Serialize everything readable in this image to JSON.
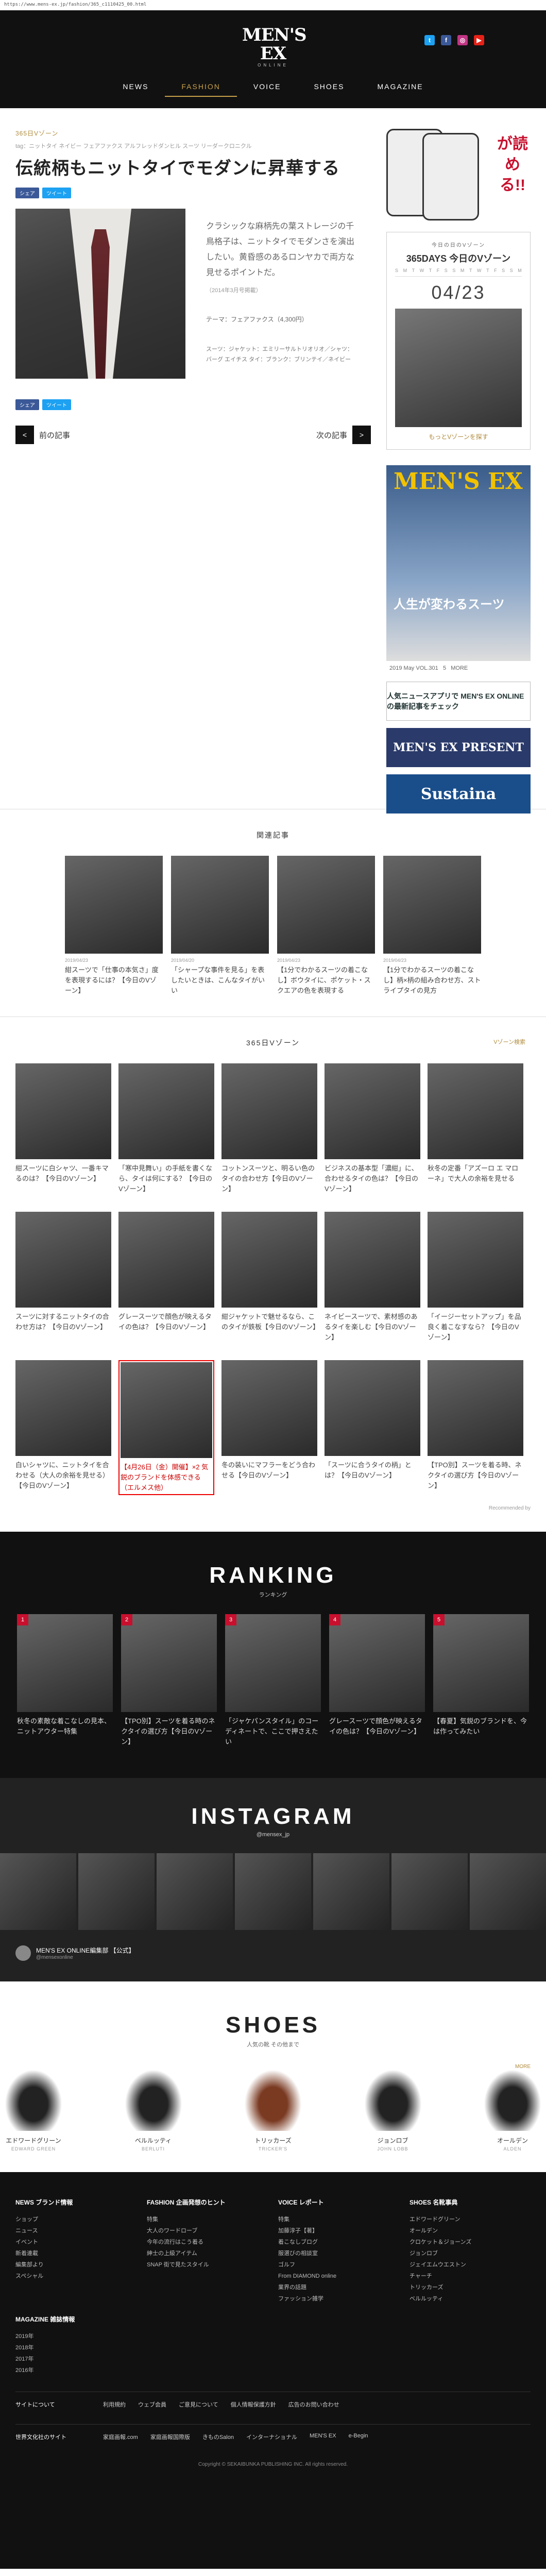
{
  "url": "https://www.mens-ex.jp/fashion/365_c1110425_00.html",
  "brand": {
    "logo_main": "MEN'S EX",
    "logo_sub": "ONLINE"
  },
  "social": [
    {
      "icon": "twitter-icon",
      "label": "t",
      "color": "#1da1f2"
    },
    {
      "icon": "facebook-icon",
      "label": "f",
      "color": "#3b5998"
    },
    {
      "icon": "instagram-icon",
      "label": "◎",
      "color": "#c13584"
    },
    {
      "icon": "youtube-icon",
      "label": "▶",
      "color": "#e62117"
    }
  ],
  "nav": [
    "NEWS",
    "FASHION",
    "VOICE",
    "SHOES",
    "MAGAZINE"
  ],
  "article": {
    "category": "365日Vゾーン",
    "tags": "tag：ニットタイ  ネイビー  フェアファクス  アルフレッドダンヒル  スーツ  リーダークロニクル",
    "title": "伝統柄もニットタイでモダンに昇華する",
    "share_fb": "シェア",
    "share_tw": "ツイート",
    "body": "クラシックな麻柄先の葉ストレージの千鳥格子は、ニットタイでモダンさを演出したい。黄昏感のあるロンヤカで両方な見せるポイントだ。",
    "date": "（2014年3月号掲載）",
    "theme": "テーマ：フェアファクス（4,300円）",
    "credit": "スーツ：ジャケット：エミリーサルトリオリオ／シャツ：バーグ エイチス\nタイ：ブランク：ブリンテイ／ネイビー",
    "prev": "前の記事",
    "next": "次の記事"
  },
  "side": {
    "yomeru": "が読める!!",
    "t1": "今日の日のVゾーン",
    "t2": "365DAYS 今日のVゾーン",
    "cal": [
      "S",
      "M",
      "T",
      "W",
      "T",
      "F",
      "S",
      "S",
      "M",
      "T",
      "W",
      "T",
      "F",
      "S",
      "S",
      "M"
    ],
    "bigdate": "04/23",
    "more": "もっとVゾーンを探す",
    "mag_logo": "MEN'S EX",
    "mag_title": "人生が変わるスーツ",
    "mag_caption": "2019 May VOL.301",
    "mag_no": "5",
    "mag_more": "MORE",
    "banner1": "人気ニュースアプリで MEN'S EX ONLINE の最新記事をチェック",
    "banner2": "MEN'S EX PRESENT",
    "banner3": "Sustaina"
  },
  "related": {
    "title": "関連記事",
    "items": [
      {
        "date": "2019/04/23",
        "text": "紺スーツで「仕事の本気さ」度を表現するには？【今日のVゾーン】"
      },
      {
        "date": "2019/04/20",
        "text": "「シャープな事件を見る」を表したいときは、こんなタイがいい"
      },
      {
        "date": "2019/04/23",
        "text": "【1分でわかるスーツの着こなし】ボウタイに、ポケット・スクエアの色を表現する"
      },
      {
        "date": "2019/04/23",
        "text": "【1分でわかるスーツの着こなし】柄×柄の組み合わせ方、ストライプタイの見方"
      }
    ]
  },
  "vzone": {
    "title": "365日Vゾーン",
    "more": "Vゾーン検索",
    "items": [
      {
        "text": "紺スーツに白シャツ、一番キマるのは？【今日のVゾーン】"
      },
      {
        "text": "「寒中見舞い」の手紙を書くなら、タイは何にする？【今日のVゾーン】"
      },
      {
        "text": "コットンスーツと、明るい色のタイの合わせ方【今日のVゾーン】"
      },
      {
        "text": "ビジネスの基本型「濃紺」に、合わせるタイの色は？【今日のVゾーン】"
      },
      {
        "text": "秋冬の定番「アズーロ エ マローネ」で大人の余裕を見せる"
      },
      {
        "text": "スーツに対するニットタイの合わせ方は？【今日のVゾーン】"
      },
      {
        "text": "グレースーツで顔色が映えるタイの色は？【今日のVゾーン】"
      },
      {
        "text": "紺ジャケットで魅せるなら、このタイが鉄板【今日のVゾーン】"
      },
      {
        "text": "ネイビースーツで、素材感のあるタイを楽しむ【今日のVゾーン】"
      },
      {
        "text": "「イージーセットアップ」を品良く着こなすなら？【今日のVゾーン】"
      },
      {
        "text": "白いシャツに、ニットタイを合わせる（大人の余裕を見せる）【今日のVゾーン】"
      },
      {
        "text": "【4月26日（金）開催】×2 気鋭のブランドを体感できる（エルメス他）"
      },
      {
        "text": "冬の装いにマフラーをどう合わせる【今日のVゾーン】"
      },
      {
        "text": "「スーツに合うタイの柄」とは？【今日のVゾーン】"
      },
      {
        "text": "【TPO別】スーツを着る時、ネクタイの選び方【今日のVゾーン】"
      }
    ],
    "sponsor": "Recommended by"
  },
  "ranking": {
    "title": "RANKING",
    "sub": "ランキング",
    "items": [
      {
        "no": "1",
        "text": "秋冬の素敵な着こなしの見本、ニットアウター特集"
      },
      {
        "no": "2",
        "text": "【TPO別】スーツを着る時のネクタイの選び方【今日のVゾーン】"
      },
      {
        "no": "3",
        "text": "「ジャケパンスタイル」のコーディネートで、ここで押さえたい"
      },
      {
        "no": "4",
        "text": "グレースーツで顔色が映えるタイの色は？【今日のVゾーン】"
      },
      {
        "no": "5",
        "text": "【春夏】気鋭のブランドを、今は作ってみたい"
      }
    ]
  },
  "insta": {
    "title": "INSTAGRAM",
    "sub": "@mensex_jp",
    "user": "MEN'S EX ONLINE編集部 【公式】",
    "handle": "@mensexonline"
  },
  "shoes": {
    "title": "SHOES",
    "sub": "人気の靴 その他まで",
    "more": "MORE",
    "items": [
      {
        "name": "エドワードグリーン",
        "en": "EDWARD GREEN",
        "brown": false
      },
      {
        "name": "ベルルッティ",
        "en": "BERLUTI",
        "brown": false
      },
      {
        "name": "トリッカーズ",
        "en": "TRICKER'S",
        "brown": true
      },
      {
        "name": "ジョンロブ",
        "en": "JOHN LOBB",
        "brown": false
      },
      {
        "name": "オールデン",
        "en": "ALDEN",
        "brown": false
      }
    ]
  },
  "footer": {
    "cols": [
      {
        "title": "NEWS ブランド情報",
        "items": [
          "ショップ",
          "ニュース",
          "イベント",
          "新着連載",
          "編集部より",
          "スペシャル"
        ]
      },
      {
        "title": "FASHION 企画発想のヒント",
        "items": [
          "特集",
          "大人のワードローブ",
          "今年の流行はこう着る",
          "紳士の上級アイテム",
          "",
          "SNAP 街で見たスタイル"
        ]
      },
      {
        "title": "VOICE レポート",
        "items": [
          "特集",
          "加藤淳子【著】",
          "着こなしブログ",
          "服選びの相談室",
          "ゴルフ",
          "From DIAMOND online",
          "業界の話題",
          "ファッション雑学"
        ]
      },
      {
        "title": "SHOES 名靴事典",
        "items": [
          "エドワードグリーン",
          "オールデン",
          "クロケット＆ジョーンズ",
          "ジョンロブ",
          "ジェイエムウエストン",
          "チャーチ",
          "トリッカーズ",
          "ベルルッティ"
        ]
      }
    ],
    "mag_title": "MAGAZINE 雑誌情報",
    "mag_items": [
      "2019年",
      "2018年",
      "2017年",
      "2016年"
    ],
    "site_label": "サイトについて",
    "site_links": [
      "利用規約",
      "ウェブ会員",
      "ご意見について",
      "個人情報保護方針",
      "広告のお問い合わせ"
    ],
    "sister_label": "世界文化社のサイト",
    "sister_links": [
      "家庭画報.com",
      "家庭画報国際版",
      "きものSalon",
      "インターナショナル",
      "MEN'S EX",
      "e-Begin"
    ],
    "copyright": "Copyright © SEKAIBUNKA PUBLISHING INC. All rights reserved."
  }
}
